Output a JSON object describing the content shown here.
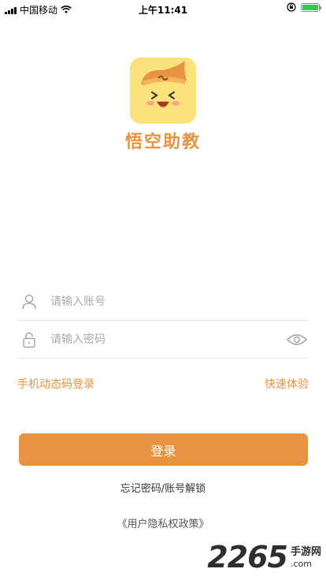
{
  "status_bar": {
    "carrier": "中国移动",
    "time": "上午11:41"
  },
  "app": {
    "name": "悟空助教",
    "brand_color": "#e8933f",
    "logo_bg_color": "#fbe27a"
  },
  "form": {
    "account_placeholder": "请输入账号",
    "password_placeholder": "请输入密码",
    "account_icon": "user-icon",
    "password_icon": "lock-icon",
    "visibility_icon": "eye-icon"
  },
  "links": {
    "sms_login": "手机动态码登录",
    "quick_trial": "快速体验",
    "forgot": "忘记密码/账号解锁",
    "policy": "《用户隐私权政策》"
  },
  "login_button": "登录",
  "watermark": {
    "number": "2265",
    "site_cn": "手游网",
    "site_domain": ".com"
  }
}
